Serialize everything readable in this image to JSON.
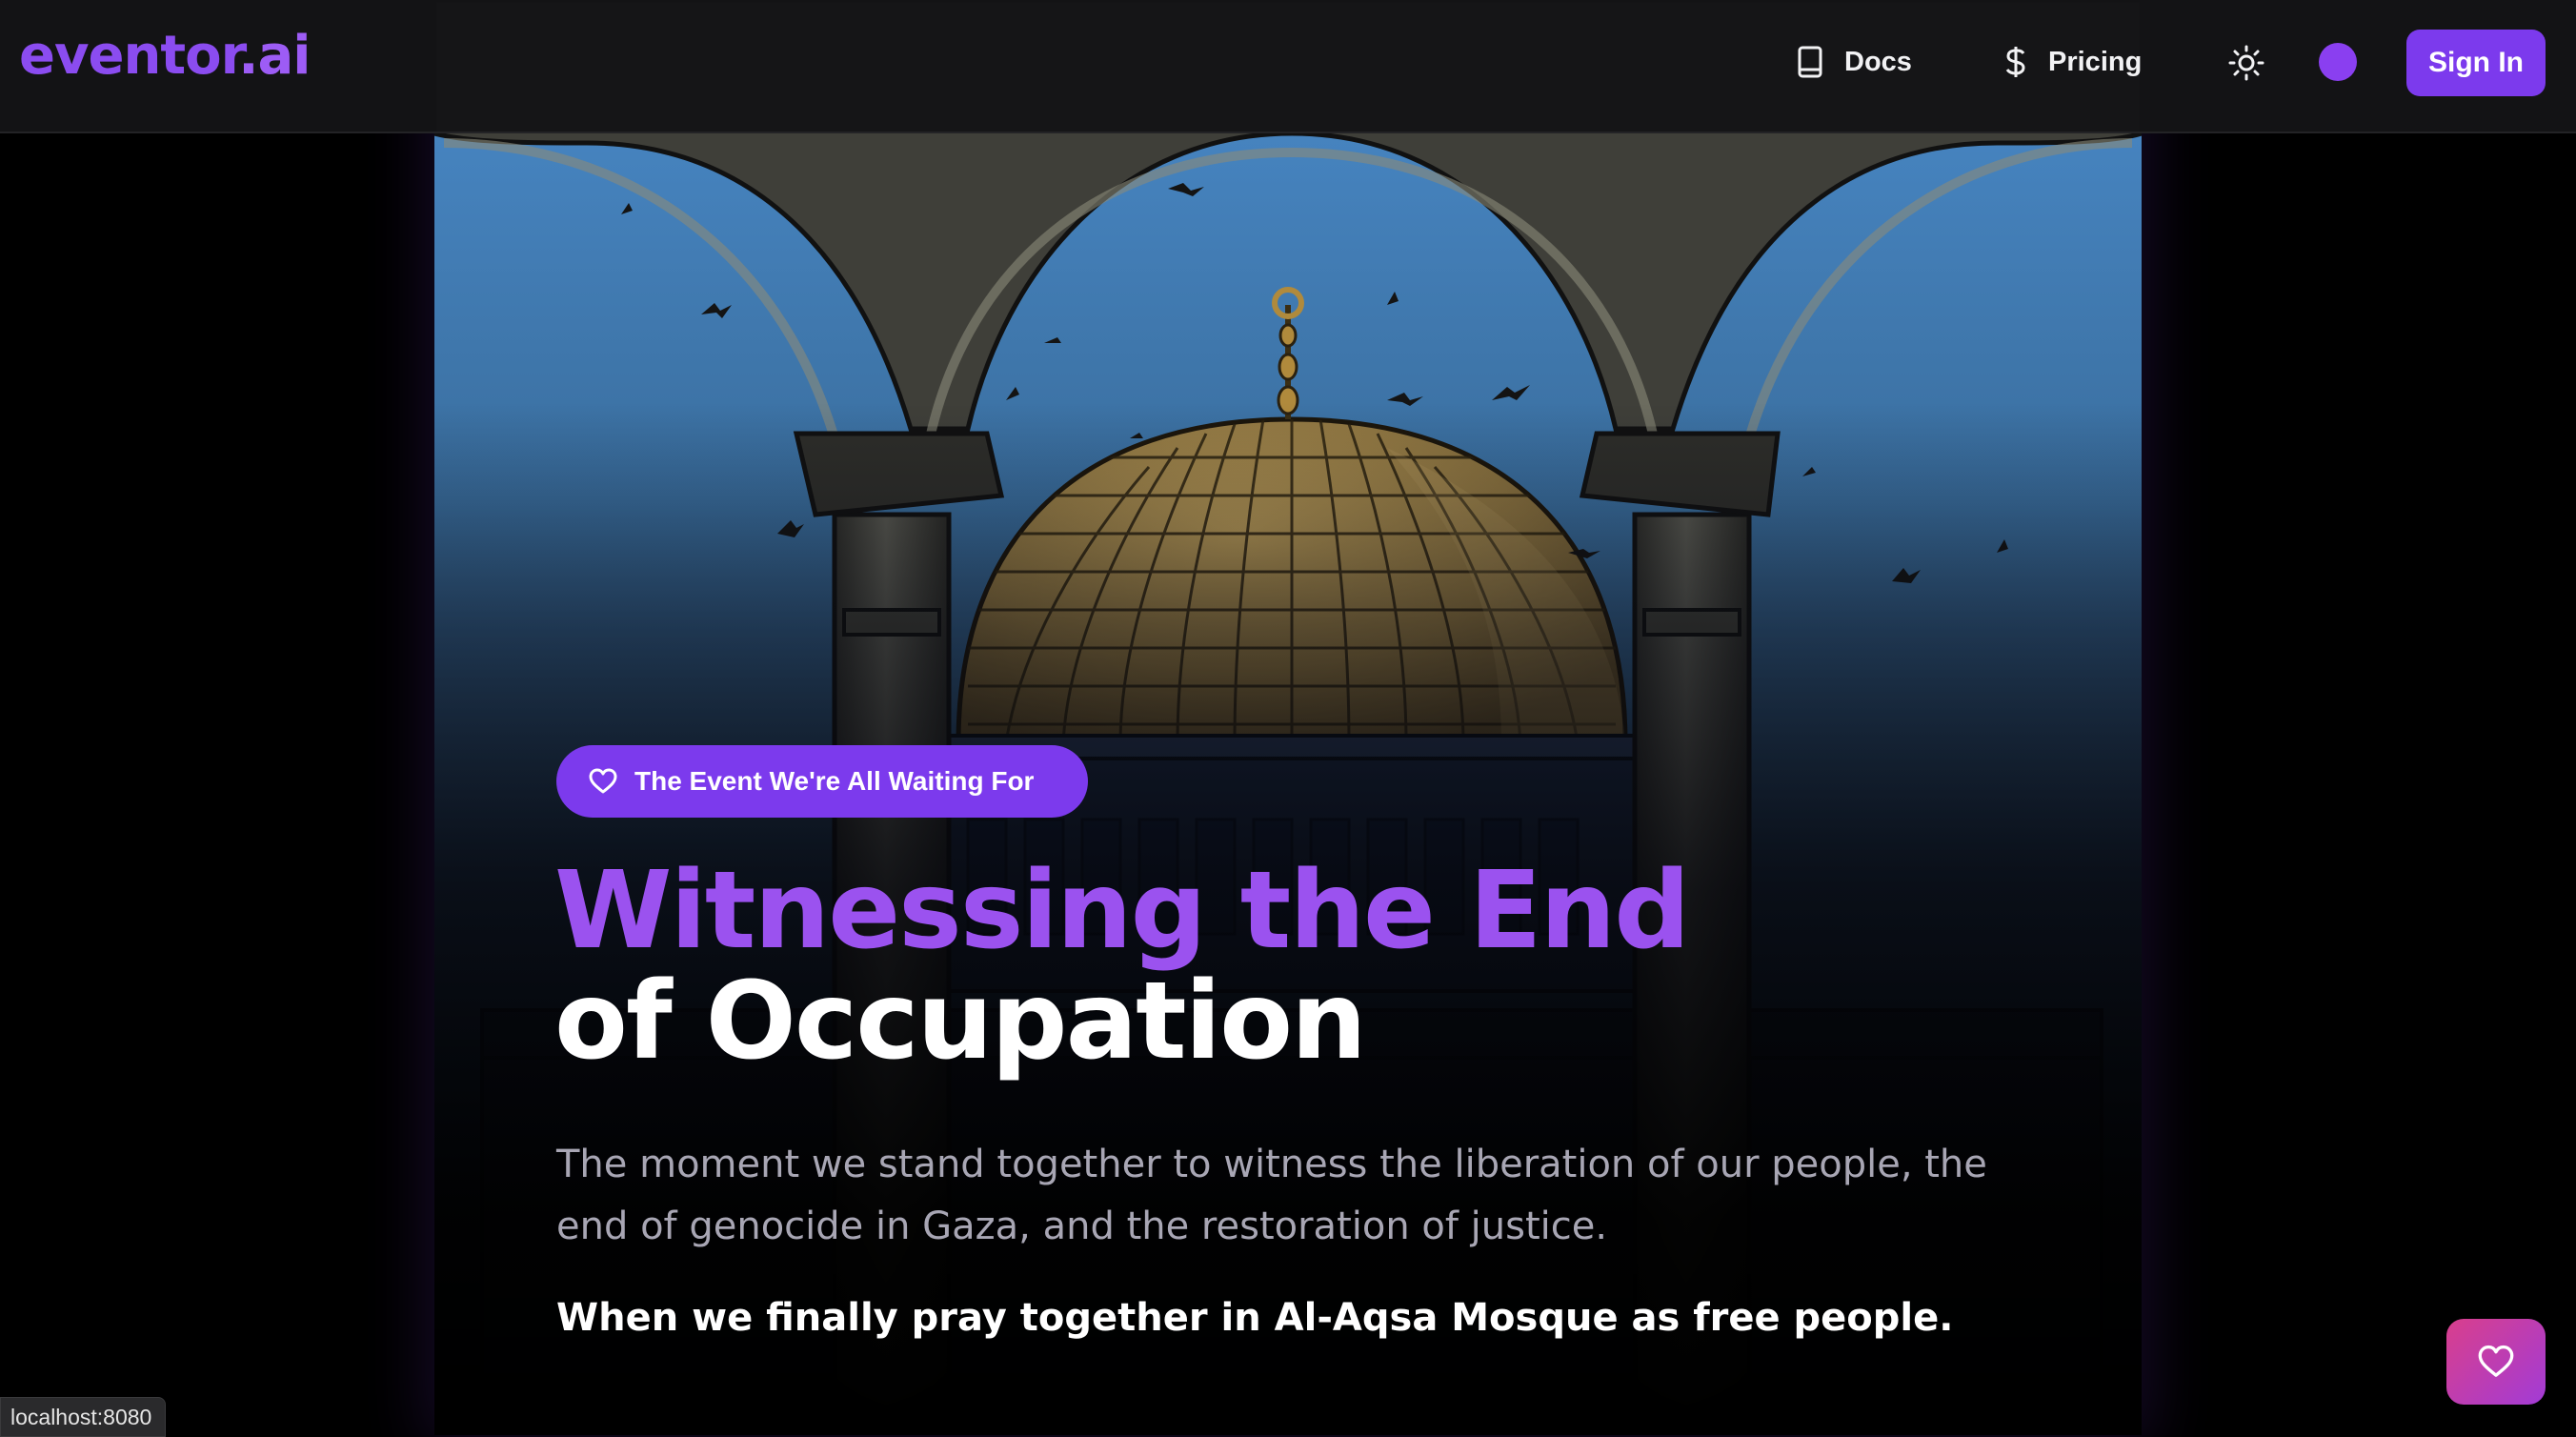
{
  "header": {
    "logo_main": "eventor",
    "logo_suffix": ".ai",
    "nav": [
      {
        "label": "Docs",
        "icon": "book-icon"
      },
      {
        "label": "Pricing",
        "icon": "dollar-icon"
      }
    ],
    "theme_icon": "sun-icon",
    "sign_in_label": "Sign In"
  },
  "hero": {
    "badge_label": "The Event We're All Waiting For",
    "badge_icon": "heart-icon",
    "title_line1": "Witnessing the End",
    "title_line2": "of Occupation",
    "description": "The moment we stand together to witness the liberation of our people, the end of genocide in Gaza, and the restoration of justice.",
    "emphasis": "When we finally pray together in Al-Aqsa Mosque as free people."
  },
  "status_bar": {
    "url": "localhost:8080"
  },
  "floating_button": {
    "icon": "heart-icon"
  },
  "colors": {
    "accent": "#7c3aed",
    "title_gradient": "#9b52ef",
    "sky_top": "#4a86c4",
    "dome_gold": "#9c8248"
  }
}
